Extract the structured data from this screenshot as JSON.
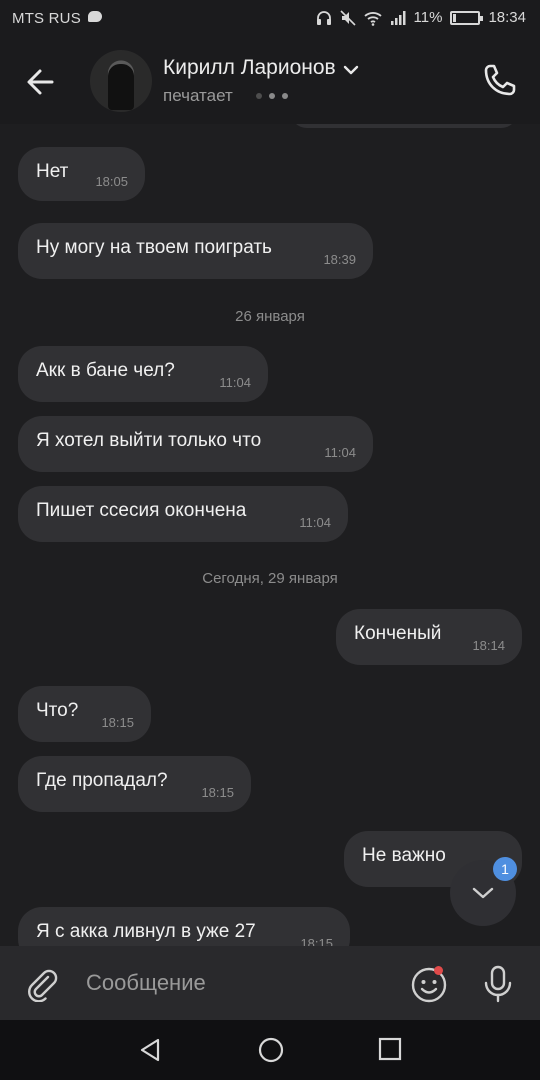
{
  "status_bar": {
    "carrier": "MTS RUS",
    "battery_percent": "11%",
    "battery_level": 0.11,
    "time": "18:34",
    "icons": [
      "message-icon",
      "headset-icon",
      "mute-icon",
      "wifi-icon",
      "signal-icon",
      "battery-icon"
    ]
  },
  "header": {
    "contact_name": "Кирилл Ларионов",
    "status": "печатает",
    "icons": [
      "back-arrow-icon",
      "avatar",
      "chevron-down-icon",
      "phone-icon"
    ]
  },
  "messages": [
    {
      "dir": "in",
      "text": "Нет",
      "time": "18:05"
    },
    {
      "dir": "in",
      "text": "Ну могу на твоем поиграть",
      "time": "18:39"
    },
    {
      "dir": "sep",
      "text": "26 января"
    },
    {
      "dir": "in",
      "text": "Акк в бане чел?",
      "time": "11:04"
    },
    {
      "dir": "in",
      "text": "Я хотел выйти только что",
      "time": "11:04"
    },
    {
      "dir": "in",
      "text": "Пишет ссесия окончена",
      "time": "11:04"
    },
    {
      "dir": "sep",
      "text": "Сегодня, 29 января"
    },
    {
      "dir": "out",
      "text": "Конченый",
      "time": "18:14"
    },
    {
      "dir": "in",
      "text": "Что?",
      "time": "18:15"
    },
    {
      "dir": "in",
      "text": "Где пропадал?",
      "time": "18:15"
    },
    {
      "dir": "out",
      "text": "Не важно",
      "time": ""
    },
    {
      "dir": "in",
      "text": "Я с акка ливнул в уже 27",
      "time": "18:15"
    }
  ],
  "scroll_down": {
    "unread_count": "1"
  },
  "composer": {
    "placeholder": "Сообщение"
  },
  "colors": {
    "background": "#1e1e20",
    "bubble": "#313134",
    "accent_badge": "#4f8fe0",
    "notification_dot": "#e04a4a"
  }
}
